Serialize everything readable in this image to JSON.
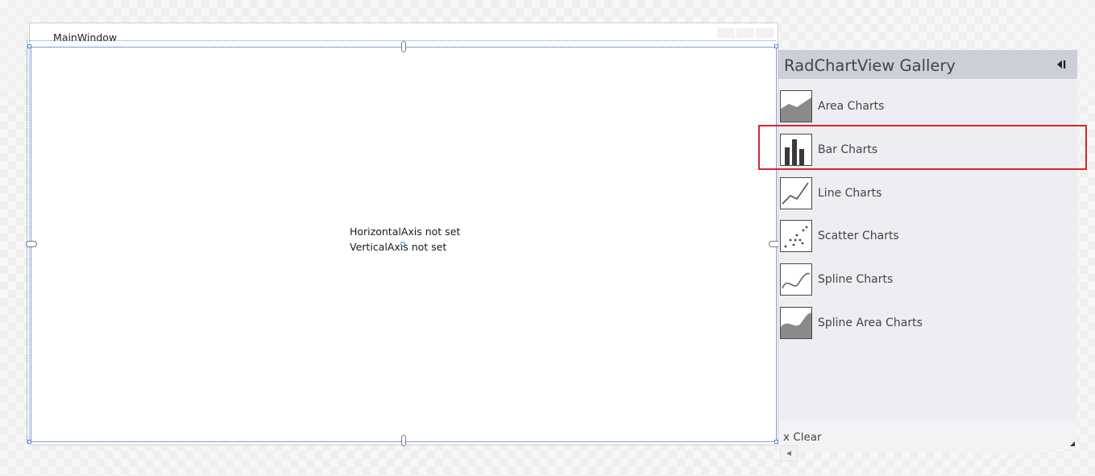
{
  "window": {
    "title": "MainWindow"
  },
  "chart": {
    "horizontal_axis_message": "HorizontalAxis not set",
    "vertical_axis_message": "VerticalAxis not set"
  },
  "gallery": {
    "title": "RadChartView Gallery",
    "collapse_icon": "collapse-left-icon",
    "items": [
      {
        "label": "Area Charts",
        "icon": "area-chart-icon"
      },
      {
        "label": "Bar Charts",
        "icon": "bar-chart-icon",
        "highlighted": true
      },
      {
        "label": "Line Charts",
        "icon": "line-chart-icon"
      },
      {
        "label": "Scatter Charts",
        "icon": "scatter-chart-icon"
      },
      {
        "label": "Spline Charts",
        "icon": "spline-chart-icon"
      },
      {
        "label": "Spline Area Charts",
        "icon": "spline-area-chart-icon"
      }
    ],
    "clear_label": "x Clear"
  },
  "colors": {
    "selection_blue": "#7b9be0",
    "highlight_red": "#d9262c",
    "gallery_header": "#ccced8",
    "gallery_background": "#eeeef2"
  }
}
